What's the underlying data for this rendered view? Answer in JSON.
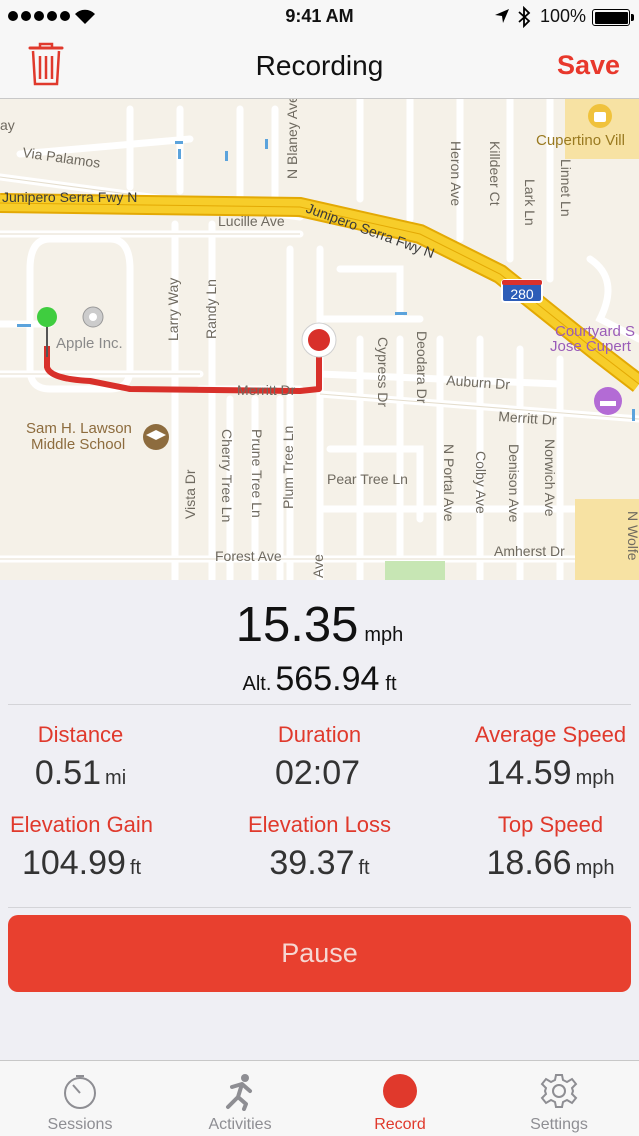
{
  "status_bar": {
    "time": "9:41 AM",
    "battery": "100%"
  },
  "nav": {
    "title": "Recording",
    "save_label": "Save",
    "trash_icon": "trash-icon"
  },
  "map": {
    "street_labels": [
      "Via Palamos",
      "N Blaney Ave",
      "Junipero Serra Fwy N",
      "Lucille Ave",
      "Junipero Serra Fwy N",
      "Heron Ave",
      "Killdeer Ct",
      "Lark Ln",
      "Linnet Ln",
      "Cupertino Vill",
      "Larry Way",
      "Randy Ln",
      "Apple Inc.",
      "280",
      "Courtyard S",
      "Jose Cupert",
      "Cypress Dr",
      "Deodara Dr",
      "Auburn Dr",
      "Merritt Dr",
      "Merritt Dr",
      "Sam H. Lawson",
      "Middle School",
      "Vista Dr",
      "Cherry Tree Ln",
      "Prune Tree Ln",
      "Plum Tree Ln",
      "Pear Tree Ln",
      "N Portal Ave",
      "Colby Ave",
      "Denison Ave",
      "Norwich Ave",
      "Forest Ave",
      "Amherst Dr",
      "N Wolfe",
      "ay",
      "Ave"
    ]
  },
  "stats": {
    "speed": {
      "value": "15.35",
      "unit": "mph"
    },
    "altitude": {
      "prefix": "Alt.",
      "value": "565.94",
      "unit": "ft"
    },
    "cells": [
      {
        "label": "Distance",
        "value": "0.51",
        "unit": "mi"
      },
      {
        "label": "Duration",
        "value": "02:07",
        "unit": ""
      },
      {
        "label": "Average Speed",
        "value": "14.59",
        "unit": "mph"
      },
      {
        "label": "Elevation Gain",
        "value": "104.99",
        "unit": "ft"
      },
      {
        "label": "Elevation Loss",
        "value": "39.37",
        "unit": "ft"
      },
      {
        "label": "Top Speed",
        "value": "18.66",
        "unit": "mph"
      }
    ],
    "pause_label": "Pause"
  },
  "tabs": [
    {
      "label": "Sessions",
      "icon": "stopwatch-icon",
      "active": false
    },
    {
      "label": "Activities",
      "icon": "runner-icon",
      "active": false
    },
    {
      "label": "Record",
      "icon": "record-icon",
      "active": true
    },
    {
      "label": "Settings",
      "icon": "gear-icon",
      "active": false
    }
  ],
  "colors": {
    "accent": "#e0392c",
    "button": "#e8402f",
    "route": "#d8302a",
    "freeway": "#f5c518"
  }
}
